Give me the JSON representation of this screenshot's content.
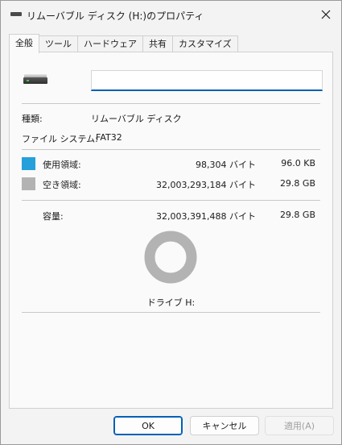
{
  "window": {
    "title": "リムーバブル ディスク (H:)のプロパティ",
    "icon": "drive-icon",
    "close_icon": "close-icon"
  },
  "tabs": [
    {
      "label": "全般",
      "active": true
    },
    {
      "label": "ツール",
      "active": false
    },
    {
      "label": "ハードウェア",
      "active": false
    },
    {
      "label": "共有",
      "active": false
    },
    {
      "label": "カスタマイズ",
      "active": false
    }
  ],
  "general": {
    "volume_label": {
      "value": "",
      "placeholder": ""
    },
    "type_label": "種類:",
    "type_value": "リムーバブル ディスク",
    "fs_label": "ファイル システム:",
    "fs_value": "FAT32",
    "used": {
      "label": "使用領域:",
      "bytes": "98,304 バイト",
      "size": "96.0 KB",
      "color": "#26a0da"
    },
    "free": {
      "label": "空き領域:",
      "bytes": "32,003,293,184 バイト",
      "size": "29.8 GB",
      "color": "#b3b3b3"
    },
    "capacity": {
      "label": "容量:",
      "bytes": "32,003,391,488 バイト",
      "size": "29.8 GB"
    },
    "drive_caption": "ドライブ H:",
    "used_fraction": 3.1e-06
  },
  "buttons": {
    "ok": "OK",
    "cancel": "キャンセル",
    "apply": "適用(A)"
  }
}
